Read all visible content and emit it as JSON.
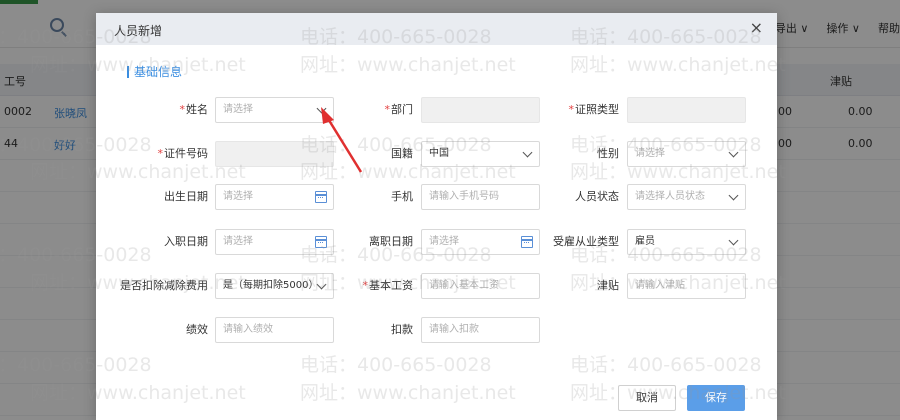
{
  "background": {
    "toolbar": [
      "导出 ∨",
      "操作 ∨",
      "帮助"
    ],
    "headers": [
      "工号",
      "津贴"
    ],
    "rows": [
      {
        "id": "0002",
        "name": "张晓凤",
        "allowance_prefix": "00",
        "allowance": "0.00"
      },
      {
        "id": "44",
        "name": "好好",
        "allowance_prefix": "00",
        "allowance": "0.00"
      }
    ]
  },
  "modal": {
    "title": "人员新增",
    "close_symbol": "×",
    "section_title": "基础信息",
    "cancel_label": "取消",
    "save_label": "保存"
  },
  "fields": {
    "name": {
      "label": "姓名",
      "required": true,
      "placeholder": "请选择",
      "value": ""
    },
    "department": {
      "label": "部门",
      "required": true,
      "value": ""
    },
    "id_type": {
      "label": "证照类型",
      "required": true,
      "value": ""
    },
    "id_number": {
      "label": "证件号码",
      "required": true,
      "value": ""
    },
    "nationality": {
      "label": "国籍",
      "required": false,
      "value": "中国"
    },
    "gender": {
      "label": "性别",
      "required": false,
      "placeholder": "请选择",
      "value": ""
    },
    "birth_date": {
      "label": "出生日期",
      "required": false,
      "placeholder": "请选择",
      "value": ""
    },
    "phone": {
      "label": "手机",
      "required": false,
      "placeholder": "请输入手机号码",
      "value": ""
    },
    "status": {
      "label": "人员状态",
      "required": false,
      "placeholder": "请选择人员状态",
      "value": ""
    },
    "hire_date": {
      "label": "入职日期",
      "required": false,
      "placeholder": "请选择",
      "value": ""
    },
    "leave_date": {
      "label": "离职日期",
      "required": false,
      "placeholder": "请选择",
      "value": ""
    },
    "employment_type": {
      "label": "受雇从业类型",
      "required": false,
      "value": "雇员"
    },
    "deduction": {
      "label": "是否扣除减除费用",
      "required": false,
      "value": "是（每期扣除5000）"
    },
    "base_salary": {
      "label": "基本工资",
      "required": true,
      "placeholder": "请输入基本工资",
      "value": ""
    },
    "allowance": {
      "label": "津贴",
      "required": false,
      "placeholder": "请输入津贴",
      "value": ""
    },
    "performance": {
      "label": "绩效",
      "required": false,
      "placeholder": "请输入绩效",
      "value": ""
    },
    "deduction_amt": {
      "label": "扣款",
      "required": false,
      "placeholder": "请输入扣款",
      "value": ""
    }
  },
  "watermark": {
    "phone": "电话：400-665-0028",
    "site": "网址：www.chanjet.net"
  },
  "colors": {
    "accent": "#3a8de0",
    "save_button": "#5b9ee8",
    "required": "#e34141",
    "arrow": "#e03030"
  }
}
